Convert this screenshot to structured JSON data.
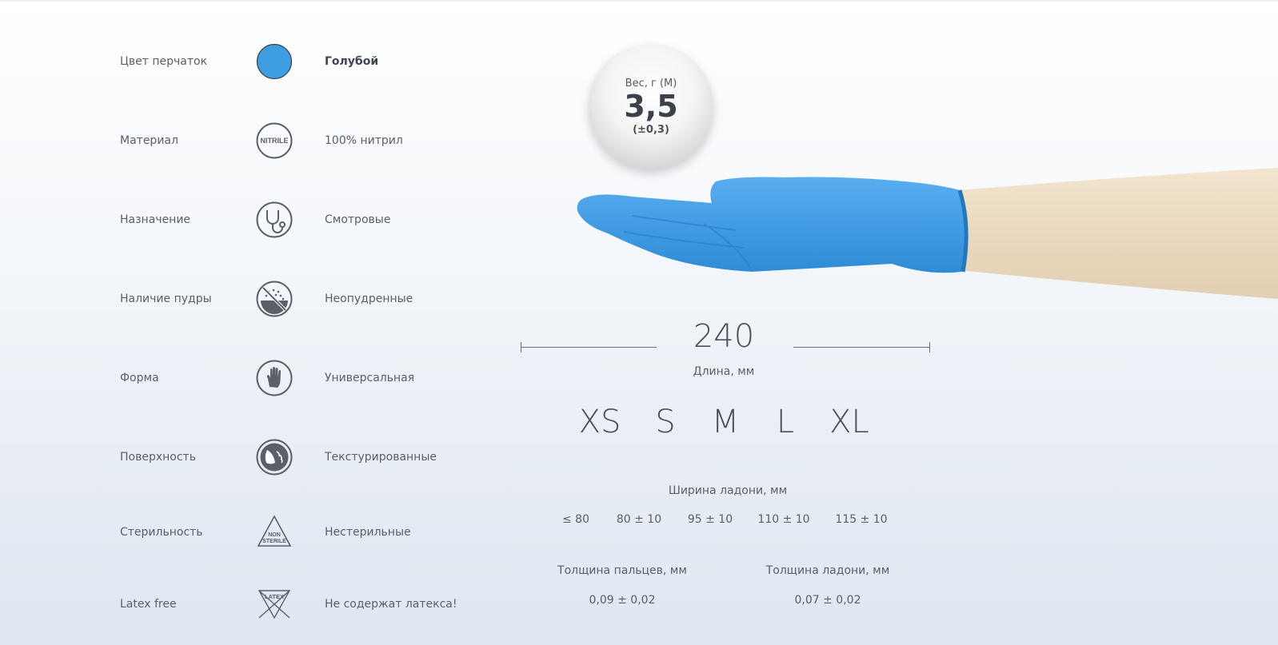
{
  "specs": [
    {
      "label": "Цвет перчаток",
      "icon": "color-swatch-icon",
      "value": "Голубой",
      "value_bold": true
    },
    {
      "label": "Материал",
      "icon": "nitrile-icon",
      "icon_text": "NITRILE",
      "value": "100% нитрил"
    },
    {
      "label": "Назначение",
      "icon": "stethoscope-icon",
      "value": "Смотровые"
    },
    {
      "label": "Наличие пудры",
      "icon": "powder-free-icon",
      "value": "Неопудренные"
    },
    {
      "label": "Форма",
      "icon": "hand-icon",
      "value": "Универсальная"
    },
    {
      "label": "Поверхность",
      "icon": "texture-icon",
      "value": "Текстурированные"
    },
    {
      "label": "Стерильность",
      "icon": "non-sterile-icon",
      "icon_text_1": "NON",
      "icon_text_2": "STERILE",
      "value": "Нестерильные"
    },
    {
      "label": "Latex free",
      "icon": "latex-free-icon",
      "icon_text": "LATEX",
      "value": "Не содержат латекса!"
    }
  ],
  "weight": {
    "label": "Вес, г (М)",
    "value": "3,5",
    "tolerance": "(±0,3)"
  },
  "length": {
    "value": "240",
    "label": "Длина, мм"
  },
  "sizes": [
    "XS",
    "S",
    "M",
    "L",
    "XL"
  ],
  "palm_width": {
    "title": "Ширина ладони, мм",
    "values": [
      "≤ 80",
      "80 ± 10",
      "95 ± 10",
      "110 ± 10",
      "115 ± 10"
    ]
  },
  "thickness": {
    "fingers": {
      "title": "Толщина пальцев, мм",
      "value": "0,09 ± 0,02"
    },
    "palm": {
      "title": "Толщина ладони, мм",
      "value": "0,07 ± 0,02"
    }
  },
  "colors": {
    "glove": "#3f9de2",
    "icon_stroke": "#5a6068",
    "skin": "#ecdcc4"
  }
}
